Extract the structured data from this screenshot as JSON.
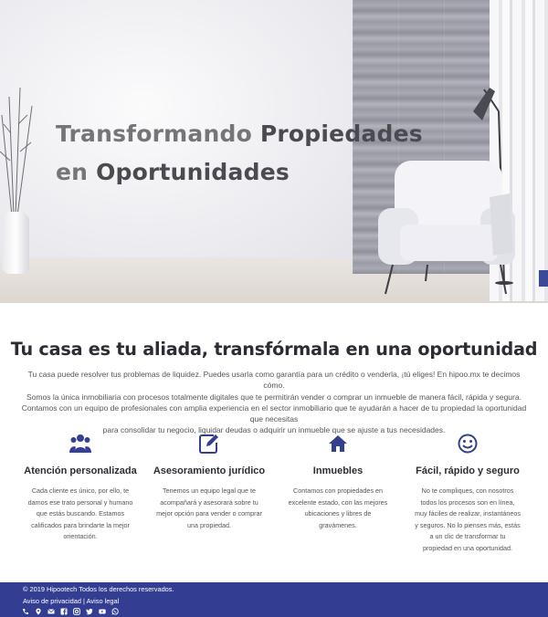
{
  "hero": {
    "title_line1_light": "Transformando",
    "title_line1_dark": "Propiedades",
    "title_line2_light": "en",
    "title_line2_dark": "Oportunidades"
  },
  "intro": {
    "title": "Tu casa es tu aliada, transfórmala en una oportunidad",
    "lines": [
      "Tu casa puede resolver tus problemas de liquidez. Puedes usarla como garantía para un crédito o venderla, ¡tú eliges! En hipoo.mx te decimos cómo.",
      "Somos la única inmobiliaria con procesos totalmente digitales que te permitirán vender o comprar un inmueble de manera fácil, rápida y segura.",
      "Contamos con un equipo de profesionales con amplia experiencia en el sector inmobiliario que te ayudarán a hacer de tu propiedad la oportunidad que necesitas",
      "para consolidar tu negocio, liquidar deudas o adquirir un inmueble que se ajuste a tus necesidades."
    ]
  },
  "features": [
    {
      "icon": "users-icon",
      "title": "Atención personalizada",
      "text": "Cada cliente es único, por ello, te damos ese trato personal y humano que estás buscando. Estamos calificados para brindarte la mejor orientación."
    },
    {
      "icon": "edit-icon",
      "title": "Asesoramiento jurídico",
      "text": "Tenemos un equipo legal que te acompañará y asesorará sobre tu mejor opción para vender o comprar una propiedad."
    },
    {
      "icon": "home-icon",
      "title": "Inmuebles",
      "text": "Contamos con propiedades en excelente estado, con las mejores ubicaciones y libres de gravámenes."
    },
    {
      "icon": "smile-icon",
      "title": "Fácil, rápido y seguro",
      "text": "No te compliques, con nosotros todos los procesos son en línea, muy fáciles de realizar, instantáneos y seguros. No lo pienses más, estás a un clic de transformar tu propiedad en una oportunidad."
    }
  ],
  "footer": {
    "copyright": "© 2019 Hipootech Todos los derechos reservados.",
    "privacy": "Aviso de privacidad",
    "separator": "|",
    "legal": "Aviso legal",
    "social_icons": [
      "phone-icon",
      "map-pin-icon",
      "email-icon",
      "facebook-icon",
      "instagram-icon",
      "twitter-icon",
      "youtube-icon",
      "whatsapp-icon"
    ]
  },
  "colors": {
    "accent": "#333d92",
    "icon": "#343f8f",
    "heading": "#2c2c34"
  }
}
